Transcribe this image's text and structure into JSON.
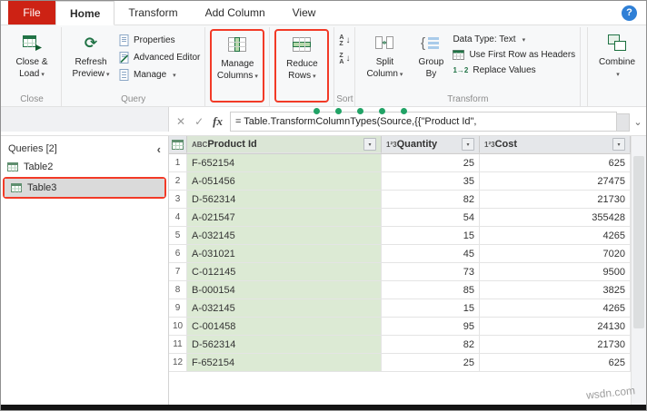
{
  "titlebar": {
    "file_tab": "File",
    "tabs": [
      "Home",
      "Transform",
      "Add Column",
      "View"
    ],
    "active_tab": "Home",
    "help": "?"
  },
  "ribbon": {
    "close_group": {
      "label": "Close",
      "close_load": {
        "line1": "Close &",
        "line2": "Load"
      }
    },
    "query_group": {
      "label": "Query",
      "refresh": {
        "line1": "Refresh",
        "line2": "Preview"
      },
      "properties": "Properties",
      "advanced_editor": "Advanced Editor",
      "manage": "Manage"
    },
    "manage_columns": {
      "line1": "Manage",
      "line2": "Columns"
    },
    "reduce_rows": {
      "line1": "Reduce",
      "line2": "Rows"
    },
    "sort_group": {
      "label": "Sort"
    },
    "transform_group": {
      "label": "Transform",
      "split_column": {
        "line1": "Split",
        "line2": "Column"
      },
      "group_by": {
        "line1": "Group",
        "line2": "By"
      },
      "data_type": "Data Type: Text",
      "first_row": "Use First Row as Headers",
      "replace_values": "Replace Values"
    },
    "combine_group": {
      "combine": "Combine"
    }
  },
  "formula_bar": {
    "formula": "= Table.TransformColumnTypes(Source,{{\"Product Id\","
  },
  "sidebar": {
    "header": "Queries [2]",
    "items": [
      {
        "label": "Table2",
        "selected": false
      },
      {
        "label": "Table3",
        "selected": true
      }
    ]
  },
  "table": {
    "columns": [
      {
        "name": "Product Id",
        "type": "text"
      },
      {
        "name": "Quantity",
        "type": "whole-number"
      },
      {
        "name": "Cost",
        "type": "whole-number"
      }
    ],
    "rows": [
      {
        "n": "1",
        "values": [
          "F-652154",
          "25",
          "625"
        ]
      },
      {
        "n": "2",
        "values": [
          "A-051456",
          "35",
          "27475"
        ]
      },
      {
        "n": "3",
        "values": [
          "D-562314",
          "82",
          "21730"
        ]
      },
      {
        "n": "4",
        "values": [
          "A-021547",
          "54",
          "355428"
        ]
      },
      {
        "n": "5",
        "values": [
          "A-032145",
          "15",
          "4265"
        ]
      },
      {
        "n": "6",
        "values": [
          "A-031021",
          "45",
          "7020"
        ]
      },
      {
        "n": "7",
        "values": [
          "C-012145",
          "73",
          "9500"
        ]
      },
      {
        "n": "8",
        "values": [
          "B-000154",
          "85",
          "3825"
        ]
      },
      {
        "n": "9",
        "values": [
          "A-032145",
          "15",
          "4265"
        ]
      },
      {
        "n": "10",
        "values": [
          "C-001458",
          "95",
          "24130"
        ]
      },
      {
        "n": "11",
        "values": [
          "D-562314",
          "82",
          "21730"
        ]
      },
      {
        "n": "12",
        "values": [
          "F-652154",
          "25",
          "625"
        ]
      }
    ]
  },
  "watermark": "wsdn.com",
  "icons": {
    "dropdown": "▾",
    "refresh": "⟳",
    "cancel": "✕",
    "check": "✓",
    "fx": "fx",
    "expand": "⌄",
    "collapse": "‹",
    "filter": "▾",
    "text_type": "ABC",
    "number_type": "1²3",
    "sort_a": "A",
    "sort_z": "Z",
    "sort_arrow": "↓",
    "replace": "1→2"
  },
  "colors": {
    "file_red": "#cd2214",
    "accent_green": "#217346",
    "highlight_red": "#f23a27",
    "selected_col_bg": "#dcead4",
    "selected_col_header": "#dbe6d6",
    "dot_green": "#21a366"
  }
}
